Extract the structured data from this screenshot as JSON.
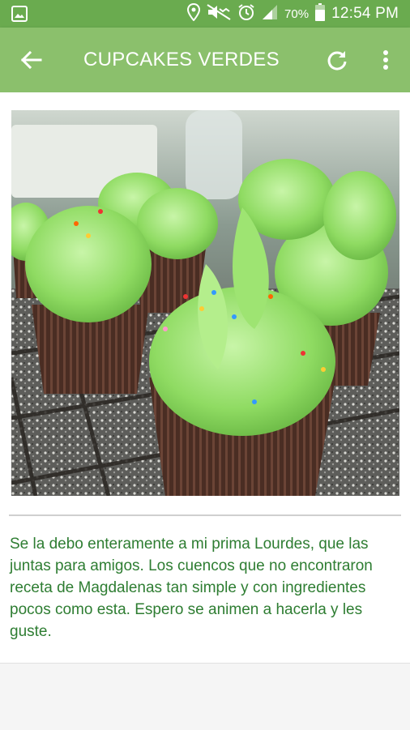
{
  "status_bar": {
    "battery": "70%",
    "time": "12:54 PM",
    "icons": [
      "image-icon",
      "location-icon",
      "mute-icon",
      "alarm-icon",
      "signal-icon",
      "battery-icon"
    ]
  },
  "toolbar": {
    "title": "CUPCAKES VERDES",
    "back_icon": "arrow-back-icon",
    "refresh_icon": "refresh-icon",
    "more_icon": "more-vert-icon"
  },
  "recipe": {
    "photo_alt": "green-cupcakes-photo",
    "description": "Se la debo enteramente a mi prima Lourdes, que las juntas para amigos. Los cuencos que no encontraron receta de Magdalenas tan simple y con ingredientes pocos como esta. Espero se animen a hacerla y les guste."
  },
  "colors": {
    "status_bar": "#6aab4f",
    "toolbar": "#8bc06c",
    "text": "#2e7d32"
  }
}
